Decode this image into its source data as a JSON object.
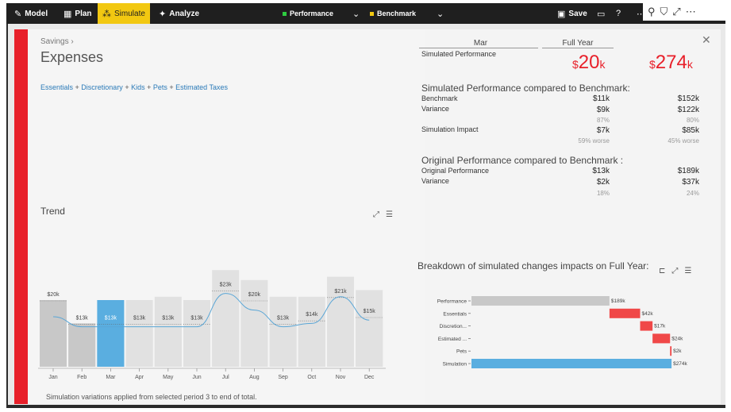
{
  "toolbar": {
    "items": [
      {
        "label": "Model",
        "icon": "wrench-icon"
      },
      {
        "label": "Plan",
        "icon": "table-icon"
      },
      {
        "label": "Simulate",
        "icon": "simulate-icon",
        "active": true
      },
      {
        "label": "Analyze",
        "icon": "analyze-icon"
      }
    ],
    "selectors": [
      {
        "label": "Performance",
        "color": "#2ecc40"
      },
      {
        "label": "Benchmark",
        "color": "#f2c811"
      }
    ],
    "save_label": "Save"
  },
  "panel": {
    "breadcrumb": "Savings",
    "title": "Expenses",
    "links": [
      "Essentials",
      "Discretionary",
      "Kids",
      "Pets",
      "Estimated Taxes"
    ],
    "trend_label": "Trend",
    "footnote": "Simulation variations applied from selected period 3 to end of total."
  },
  "metrics": {
    "col_mar": "Mar",
    "col_full_year": "Full Year",
    "sim_perf_label": "Simulated Performance",
    "sim_perf_mar": "20",
    "sim_perf_fy": "274",
    "currency": "$",
    "unit": "k",
    "compare_bench_title": "Simulated Performance compared to Benchmark:",
    "benchmark_label": "Benchmark",
    "benchmark_mar": "$11k",
    "benchmark_fy": "$152k",
    "variance_label": "Variance",
    "variance_mar": "$9k",
    "variance_fy": "$122k",
    "variance_pct_mar": "87%",
    "variance_pct_fy": "80%",
    "sim_impact_label": "Simulation Impact",
    "sim_impact_mar": "$7k",
    "sim_impact_fy": "$85k",
    "sim_impact_note_mar": "59% worse",
    "sim_impact_note_fy": "45% worse",
    "orig_bench_title": "Original Performance compared to Benchmark :",
    "orig_perf_label": "Original Performance",
    "orig_perf_mar": "$13k",
    "orig_perf_fy": "$189k",
    "orig_var_label": "Variance",
    "orig_var_mar": "$2k",
    "orig_var_fy": "$37k",
    "orig_var_pct_mar": "18%",
    "orig_var_pct_fy": "24%"
  },
  "breakdown": {
    "title": "Breakdown of simulated changes impacts on Full Year:"
  },
  "chart_data": [
    {
      "type": "bar",
      "categories": [
        "Jan",
        "Feb",
        "Mar",
        "Apr",
        "May",
        "Jun",
        "Jul",
        "Aug",
        "Sep",
        "Oct",
        "Nov",
        "Dec"
      ],
      "values": [
        20,
        13,
        13,
        13,
        13,
        13,
        23,
        20,
        13,
        14,
        21,
        15
      ],
      "bar_totals": [
        20,
        13,
        20,
        20,
        21,
        20,
        29,
        26,
        21,
        21,
        27,
        23
      ],
      "labels": [
        "$20k",
        "$13k",
        "$13k",
        "$13k",
        "$13k",
        "$13k",
        "$23k",
        "$20k",
        "$13k",
        "$14k",
        "$21k",
        "$15k"
      ],
      "line": [
        15,
        12,
        12,
        12,
        12,
        12,
        22,
        17,
        12,
        13,
        21,
        14
      ],
      "selected_index": 2,
      "colors": {
        "bar": "#c8c8c8",
        "bar_light": "#e1e1e1",
        "selected": "#5aaee0",
        "line": "#5aa6d6"
      }
    },
    {
      "type": "bar",
      "orientation": "horizontal-waterfall",
      "categories": [
        "Performance",
        "Essentials",
        "Discretion...",
        "Estimated ...",
        "Pets",
        "Simulation"
      ],
      "values": [
        189,
        42,
        17,
        24,
        2,
        274
      ],
      "labels": [
        "$189k",
        "$42k",
        "$17k",
        "$24k",
        "$2k",
        "$274k"
      ],
      "colors": {
        "total": "#c8c8c8",
        "increase": "#f04848",
        "result": "#5aaee0"
      }
    }
  ]
}
